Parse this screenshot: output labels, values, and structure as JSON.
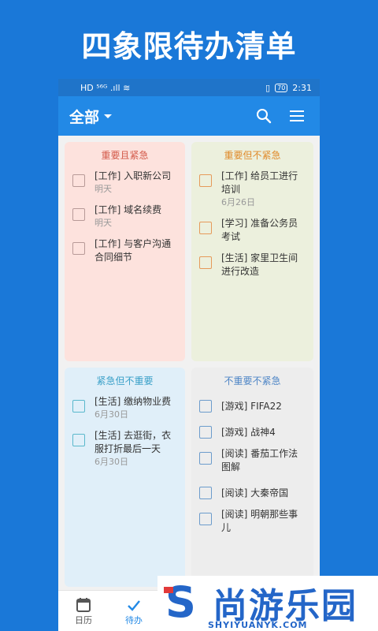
{
  "banner": {
    "title": "四象限待办清单"
  },
  "statusbar": {
    "left": "HD ⁵⁶ᴳ .ıll ≋",
    "battery": "70",
    "time": "2:31"
  },
  "appbar": {
    "title": "全部",
    "icons": [
      "search-icon",
      "menu-icon"
    ]
  },
  "quadrants": [
    {
      "title": "重要且紧急",
      "color": "#d35a4a",
      "items": [
        {
          "text": "[工作] 入职新公司",
          "date": "明天"
        },
        {
          "text": "[工作] 域名续费",
          "date": "明天"
        },
        {
          "text": "[工作] 与客户沟通合同细节",
          "date": ""
        }
      ]
    },
    {
      "title": "重要但不紧急",
      "color": "#e08a2a",
      "items": [
        {
          "text": "[工作] 给员工进行培训",
          "date": "6月26日"
        },
        {
          "text": "[学习] 准备公务员考试",
          "date": ""
        },
        {
          "text": "[生活] 家里卫生间进行改造",
          "date": ""
        }
      ]
    },
    {
      "title": "紧急但不重要",
      "color": "#3aa0c8",
      "items": [
        {
          "text": "[生活] 缴纳物业费",
          "date": "6月30日"
        },
        {
          "text": "[生活] 去逛街，衣服打折最后一天",
          "date": "6月30日"
        }
      ]
    },
    {
      "title": "不重要不紧急",
      "color": "#4f86c6",
      "items": [
        {
          "text": "[游戏] FIFA22",
          "date": ""
        },
        {
          "text": "[游戏] 战神4",
          "date": ""
        },
        {
          "text": "[阅读] 番茄工作法图解",
          "date": ""
        },
        {
          "text": "[阅读] 大秦帝国",
          "date": ""
        },
        {
          "text": "[阅读] 明朝那些事儿",
          "date": ""
        }
      ]
    }
  ],
  "bottom_nav": [
    {
      "label": "日历",
      "icon": "calendar-icon",
      "active": false
    },
    {
      "label": "待办",
      "icon": "check-icon",
      "active": true
    }
  ],
  "watermark": {
    "logo": "S",
    "name": "尚游乐园",
    "url": "SHYIYUANYK.COM"
  }
}
